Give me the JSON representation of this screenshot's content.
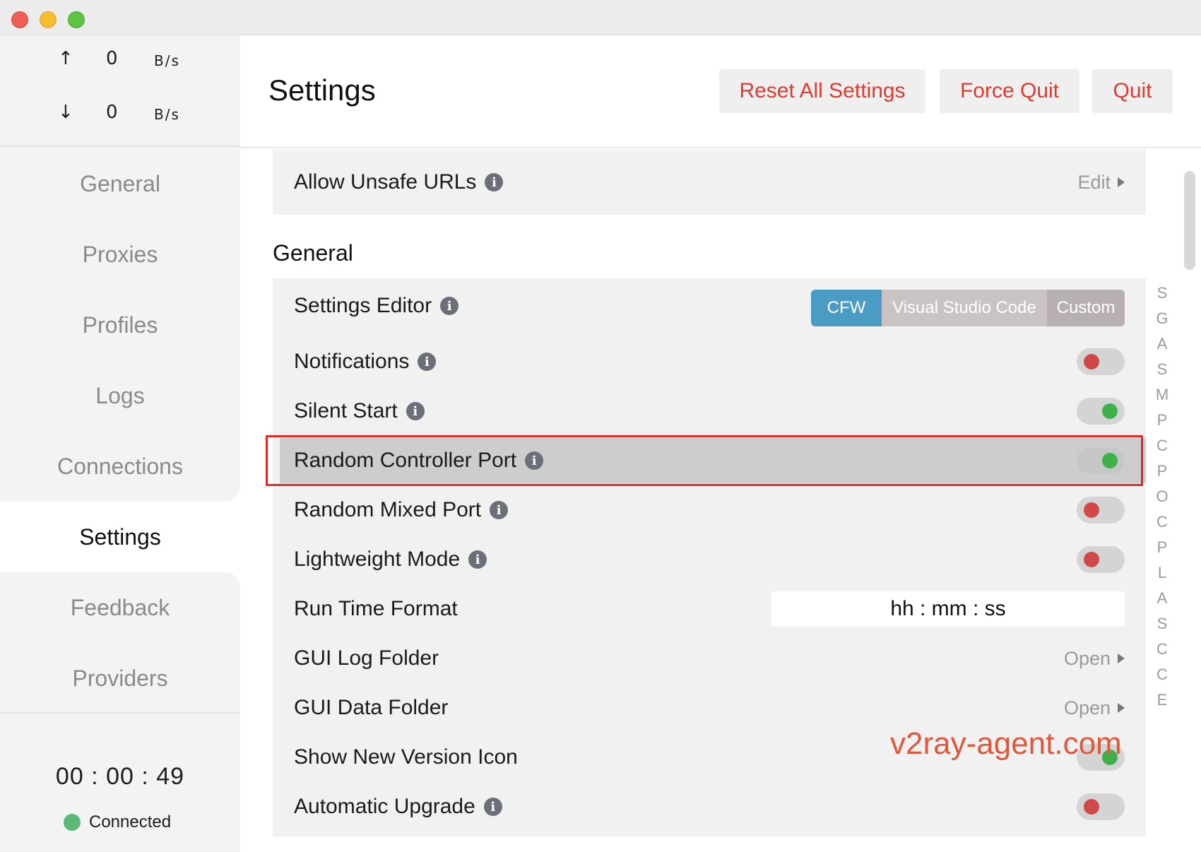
{
  "window": {
    "controls": [
      "close",
      "minimize",
      "zoom"
    ]
  },
  "traffic": {
    "up": {
      "arrow": "↑",
      "value": "0",
      "unit": "B/s"
    },
    "down": {
      "arrow": "↓",
      "value": "0",
      "unit": "B/s"
    }
  },
  "sidebar": {
    "items": [
      {
        "label": "General"
      },
      {
        "label": "Proxies"
      },
      {
        "label": "Profiles"
      },
      {
        "label": "Logs"
      },
      {
        "label": "Connections"
      },
      {
        "label": "Settings",
        "active": true
      },
      {
        "label": "Feedback"
      },
      {
        "label": "Providers"
      }
    ],
    "timer": "00 : 00 : 49",
    "status": "Connected"
  },
  "header": {
    "title": "Settings",
    "reset_label": "Reset All Settings",
    "force_quit_label": "Force Quit",
    "quit_label": "Quit"
  },
  "content": {
    "top_row": {
      "label": "Allow Unsafe URLs",
      "action": "Edit"
    },
    "section_title": "General",
    "rows": {
      "settings_editor": {
        "label": "Settings Editor",
        "options": [
          "CFW",
          "Visual Studio Code",
          "Custom"
        ],
        "selected": "CFW"
      },
      "notifications": {
        "label": "Notifications",
        "enabled": false
      },
      "silent_start": {
        "label": "Silent Start",
        "enabled": true
      },
      "random_controller_port": {
        "label": "Random Controller Port",
        "enabled": true
      },
      "random_mixed_port": {
        "label": "Random Mixed Port",
        "enabled": false
      },
      "lightweight_mode": {
        "label": "Lightweight Mode",
        "enabled": false
      },
      "run_time_format": {
        "label": "Run Time Format",
        "value": "hh : mm : ss"
      },
      "gui_log_folder": {
        "label": "GUI Log Folder",
        "action": "Open"
      },
      "gui_data_folder": {
        "label": "GUI Data Folder",
        "action": "Open"
      },
      "show_new_version_icon": {
        "label": "Show New Version Icon",
        "enabled": true
      },
      "automatic_upgrade": {
        "label": "Automatic Upgrade",
        "enabled": false
      }
    },
    "alphabet_index": [
      "S",
      "G",
      "A",
      "S",
      "M",
      "P",
      "C",
      "P",
      "O",
      "C",
      "P",
      "L",
      "A",
      "S",
      "C",
      "C",
      "E"
    ],
    "watermark": "v2ray-agent.com"
  },
  "colors": {
    "danger_text": "#e03a2f",
    "segment_active": "#4a9cc4",
    "toggle_on": "#3fb14a",
    "toggle_off": "#d04848",
    "highlight_border": "#e02a2a",
    "status_connected": "#5bb877"
  }
}
